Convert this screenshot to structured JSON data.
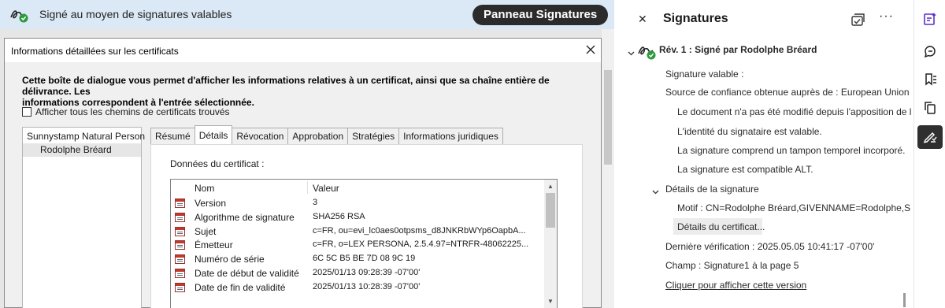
{
  "banner": {
    "status_text": "Signé au moyen de signatures valables",
    "panel_button_label": "Panneau Signatures"
  },
  "dialog": {
    "title": "Informations détaillées sur les certificats",
    "intro_line1": "Cette boîte de dialogue vous permet d'afficher les informations relatives à un certificat, ainsi que sa chaîne entière de délivrance. Les",
    "intro_line2": "informations correspondent à l'entrée sélectionnée.",
    "show_all_paths_label": "Afficher tous les chemins de certificats trouvés",
    "tree": {
      "root": "Sunnystamp Natural Person",
      "child": "Rodolphe Bréard"
    },
    "tabs": [
      "Résumé",
      "Détails",
      "Révocation",
      "Approbation",
      "Stratégies",
      "Informations juridiques"
    ],
    "active_tab": "Détails",
    "data_label": "Données du certificat :",
    "columns": {
      "name": "Nom",
      "value": "Valeur"
    },
    "rows": [
      {
        "name": "Version",
        "value": "3"
      },
      {
        "name": "Algorithme de signature",
        "value": "SHA256 RSA"
      },
      {
        "name": "Sujet",
        "value": "c=FR, ou=evi_lc0aes0otpsms_d8JNKRbWYp6OapbA..."
      },
      {
        "name": "Émetteur",
        "value": "c=FR, o=LEX PERSONA, 2.5.4.97=NTRFR-48062225..."
      },
      {
        "name": "Numéro de série",
        "value": "6C 5C B5 BE 7D 08 9C 19"
      },
      {
        "name": "Date de début de validité",
        "value": "2025/01/13 09:28:39 -07'00'"
      },
      {
        "name": "Date de fin de validité",
        "value": "2025/01/13 10:28:39 -07'00'"
      }
    ]
  },
  "panel": {
    "title": "Signatures",
    "revision_title": "Rév. 1 : Signé par Rodolphe Bréard",
    "valid_signature": "Signature valable :",
    "trust_source": "Source de confiance obtenue auprès de : European Union T",
    "checks": [
      "Le document n'a pas été modifié depuis l'apposition de la",
      "L'identité du signataire est valable.",
      "La signature comprend un tampon temporel incorporé.",
      "La signature est compatible ALT."
    ],
    "details_header": "Détails de la signature",
    "motif": "Motif : CN=Rodolphe Bréard,GIVENNAME=Rodolphe,SUR",
    "cert_details_button": "Détails du certificat...",
    "last_check": "Dernière vérification : 2025.05.05 10:41:17 -07'00'",
    "field": "Champ : Signature1 à la page 5",
    "show_version_link": "Cliquer pour afficher cette version"
  },
  "icons": {
    "close": "close-icon",
    "signature_pen": "signature-pen-icon",
    "valid_check": "check-badge-icon",
    "more": "more-options-icon"
  },
  "colors": {
    "banner_bg": "#dbe8f5",
    "valid_green": "#2d9a3e",
    "rail_icon_purple": "#5b2fc9",
    "active_tool_bg": "#2f2f2f"
  }
}
